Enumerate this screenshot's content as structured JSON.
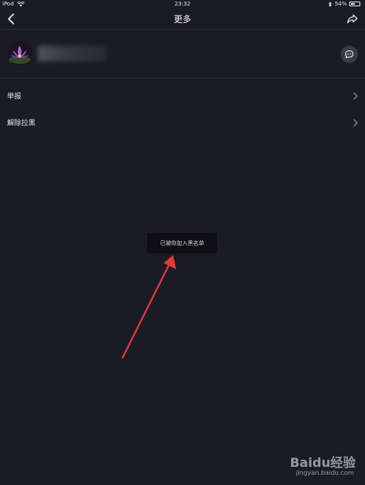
{
  "status_bar": {
    "device": "iPod",
    "time": "23:32",
    "battery_text": "54%",
    "battery_level": 0.54
  },
  "nav": {
    "title": "更多"
  },
  "menu": {
    "items": [
      {
        "label": "举报"
      },
      {
        "label": "解除拉黑"
      }
    ]
  },
  "toast": {
    "text": "已被你加入黑名单"
  },
  "watermark": {
    "brand": "Baidu经验",
    "url": "jingyan.baidu.com"
  },
  "colors": {
    "background": "#1a1b25",
    "text": "#e6e6ea",
    "toast_bg": "#0e0e14",
    "annotation_arrow": "#e53935"
  }
}
